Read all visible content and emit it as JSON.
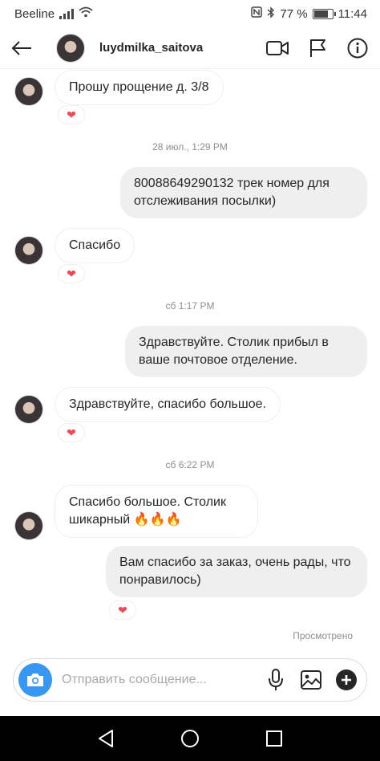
{
  "status_bar": {
    "carrier": "Beeline",
    "battery": "77 %",
    "battery_level": 0.77,
    "time": "11:44"
  },
  "header": {
    "username": "luydmilka_saitova"
  },
  "messages": [
    {
      "text": "Прошу прощение д. 3/8",
      "reaction": "❤"
    },
    {
      "timestamp": "28 июл., 1:29 PM"
    },
    {
      "text": "80088649290132 трек номер для отслеживания посылки)"
    },
    {
      "text": "Спасибо",
      "reaction": "❤"
    },
    {
      "timestamp": "сб 1:17 PM"
    },
    {
      "text": "Здравствуйте. Столик прибыл в ваше почтовое отделение."
    },
    {
      "text": "Здравствуйте, спасибо большое.",
      "reaction": "❤"
    },
    {
      "timestamp": "сб 6:22 PM"
    },
    {
      "text": "Спасибо большое. Столик шикарный 🔥🔥🔥"
    },
    {
      "text": "Вам спасибо за заказ, очень рады, что понравилось)",
      "reaction": "❤"
    }
  ],
  "seen_label": "Просмотрено",
  "composer": {
    "placeholder": "Отправить сообщение..."
  },
  "colors": {
    "accent": "#3897f0",
    "heart": "#ed4956",
    "outgoing_bubble": "#efefef"
  }
}
